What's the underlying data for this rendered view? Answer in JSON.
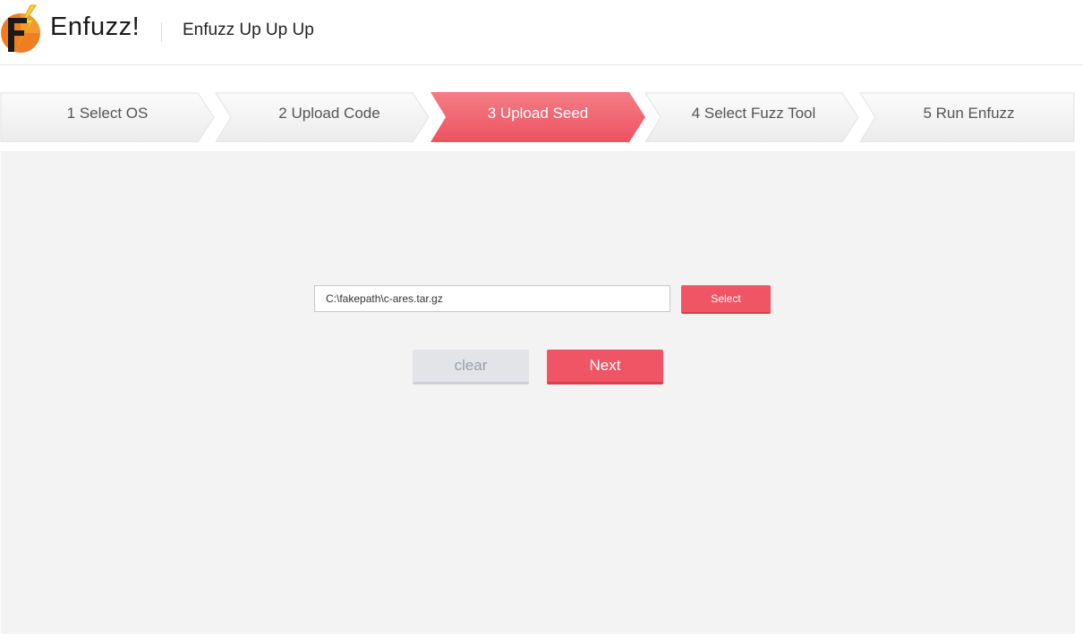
{
  "app": {
    "logo_text": "Enfuzz!",
    "subtitle": "Enfuzz Up Up Up"
  },
  "colors": {
    "accent": "#ef5565",
    "step_inactive_top": "#fbfbfb",
    "step_inactive_bottom": "#efefef",
    "step_active_top": "#f47880",
    "step_active_bottom": "#ee5562",
    "panel_bg": "#f3f3f3"
  },
  "steps": [
    {
      "label": "1 Select OS",
      "active": false
    },
    {
      "label": "2 Upload Code",
      "active": false
    },
    {
      "label": "3 Upload Seed",
      "active": true
    },
    {
      "label": "4 Select Fuzz Tool",
      "active": false
    },
    {
      "label": "5 Run Enfuzz",
      "active": false
    }
  ],
  "upload": {
    "file_value": "C:\\fakepath\\c-ares.tar.gz",
    "select_label": "Select",
    "clear_label": "clear",
    "next_label": "Next"
  }
}
